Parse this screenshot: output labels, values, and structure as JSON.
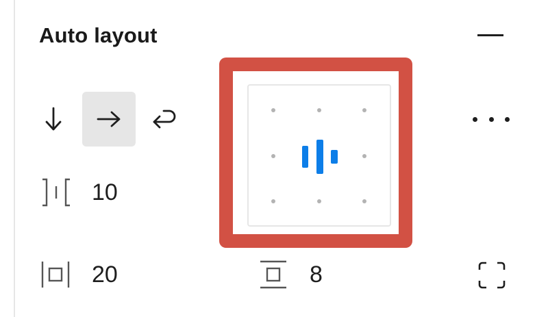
{
  "panel": {
    "title": "Auto layout"
  },
  "direction": {
    "options": [
      {
        "name": "vertical",
        "icon": "arrow-down-icon",
        "active": false
      },
      {
        "name": "horizontal",
        "icon": "arrow-right-icon",
        "active": true
      },
      {
        "name": "wrap",
        "icon": "wrap-icon",
        "active": false
      }
    ]
  },
  "spacing": {
    "gap_value": "10",
    "horizontal_padding_value": "20",
    "vertical_padding_value": "8"
  },
  "alignment": {
    "selected": "center",
    "accent_color": "#0d7ee8"
  },
  "colors": {
    "highlight": "#d25144",
    "text": "#1e1e1e",
    "active_bg": "#e6e6e6"
  }
}
